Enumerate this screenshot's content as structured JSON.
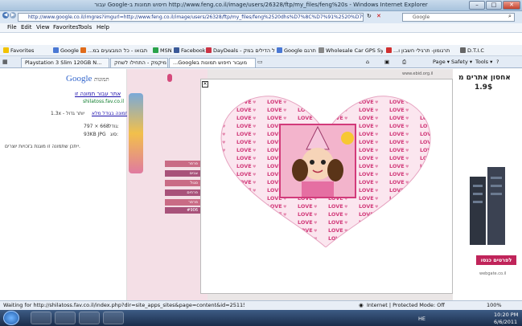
{
  "window": {
    "title": "עבור Google-חיפוש תמונות ב http://www.feng.co.il/image/users/26328/ftp/my_files/feng%20s - Windows Internet Explorer",
    "minimize": "–",
    "maximize": "□",
    "close": "✕"
  },
  "address_bar": {
    "url": "http://www.google.co.il/imgres?imgurl=http://www.feng.co.il/image/users/26328/ftp/my_files/feng%2520dhs%D7%8C%D7%91%2520%D7%91%D7%",
    "search_placeholder": "Google"
  },
  "menu": [
    "File",
    "Edit",
    "View",
    "Favorites",
    "Tools",
    "Help"
  ],
  "favorites_bar": {
    "label": "Favorites",
    "items": [
      "Google",
      "...תבואו - כל המבצעים במ",
      "MSN",
      "Facebook",
      "DayDeals - כל הדילים במק",
      "Google תרגם",
      "Wholesale Car GPS Syste...",
      "...תרגומון- תרגילי חשבון ו",
      "D.T.I.C"
    ]
  },
  "tabs": [
    {
      "label": "Playstation 3 Slim 120GB N...",
      "active": false
    },
    {
      "label": "מיקמק - התחילו לשחק",
      "active": false
    },
    {
      "label": "...Googleמעבור חיפוש תמונות ב",
      "active": true
    }
  ],
  "command_bar": [
    "Page ▾",
    "Safety ▾",
    "Tools ▾"
  ],
  "left_pane": {
    "logo_text": "Google",
    "logo_suffix": "תמונות",
    "link_title": "אתר עבור תמונה זו",
    "link_url": "shilatoss.fav.co.il",
    "full_size_link": "תמונה בגודל מלא",
    "full_size_note": "1.3x - יותר גדול",
    "size_label": "גודל:",
    "size_value": "797 × 668",
    "file_label": "סוג:",
    "file_value": "93KB JPG",
    "copyright_note": "ייתכן שתמונה זו מוגנת בזכויות יוצרים."
  },
  "website": {
    "top_right_banner": "אחסון אתרים מ",
    "price": "1.9$",
    "ad_footer": "לפרטים כנסו",
    "ad_domain": "webgate.co.il",
    "menu_items": [
      "פרפר",
      "צבים",
      "סגול",
      "פרחים",
      "פרפר",
      "#906"
    ],
    "heart_word": "LOVE",
    "header_link": "www.ebid.org.il"
  },
  "modal": {
    "close": "✕"
  },
  "status_bar": {
    "text": "Waiting for http://shilatoss.fav.co.il/index.php?dir=site_apps_sites&page=content&id=251158...",
    "zone": "Internet | Protected Mode: Off",
    "zoom": "100%"
  },
  "taskbar": {
    "lang": "HE",
    "time": "10:20 PM",
    "date": "6/6/2011"
  },
  "colors": {
    "heart": "#d23a7a",
    "heart_light": "#f6c6da",
    "accent": "#c0245a"
  }
}
